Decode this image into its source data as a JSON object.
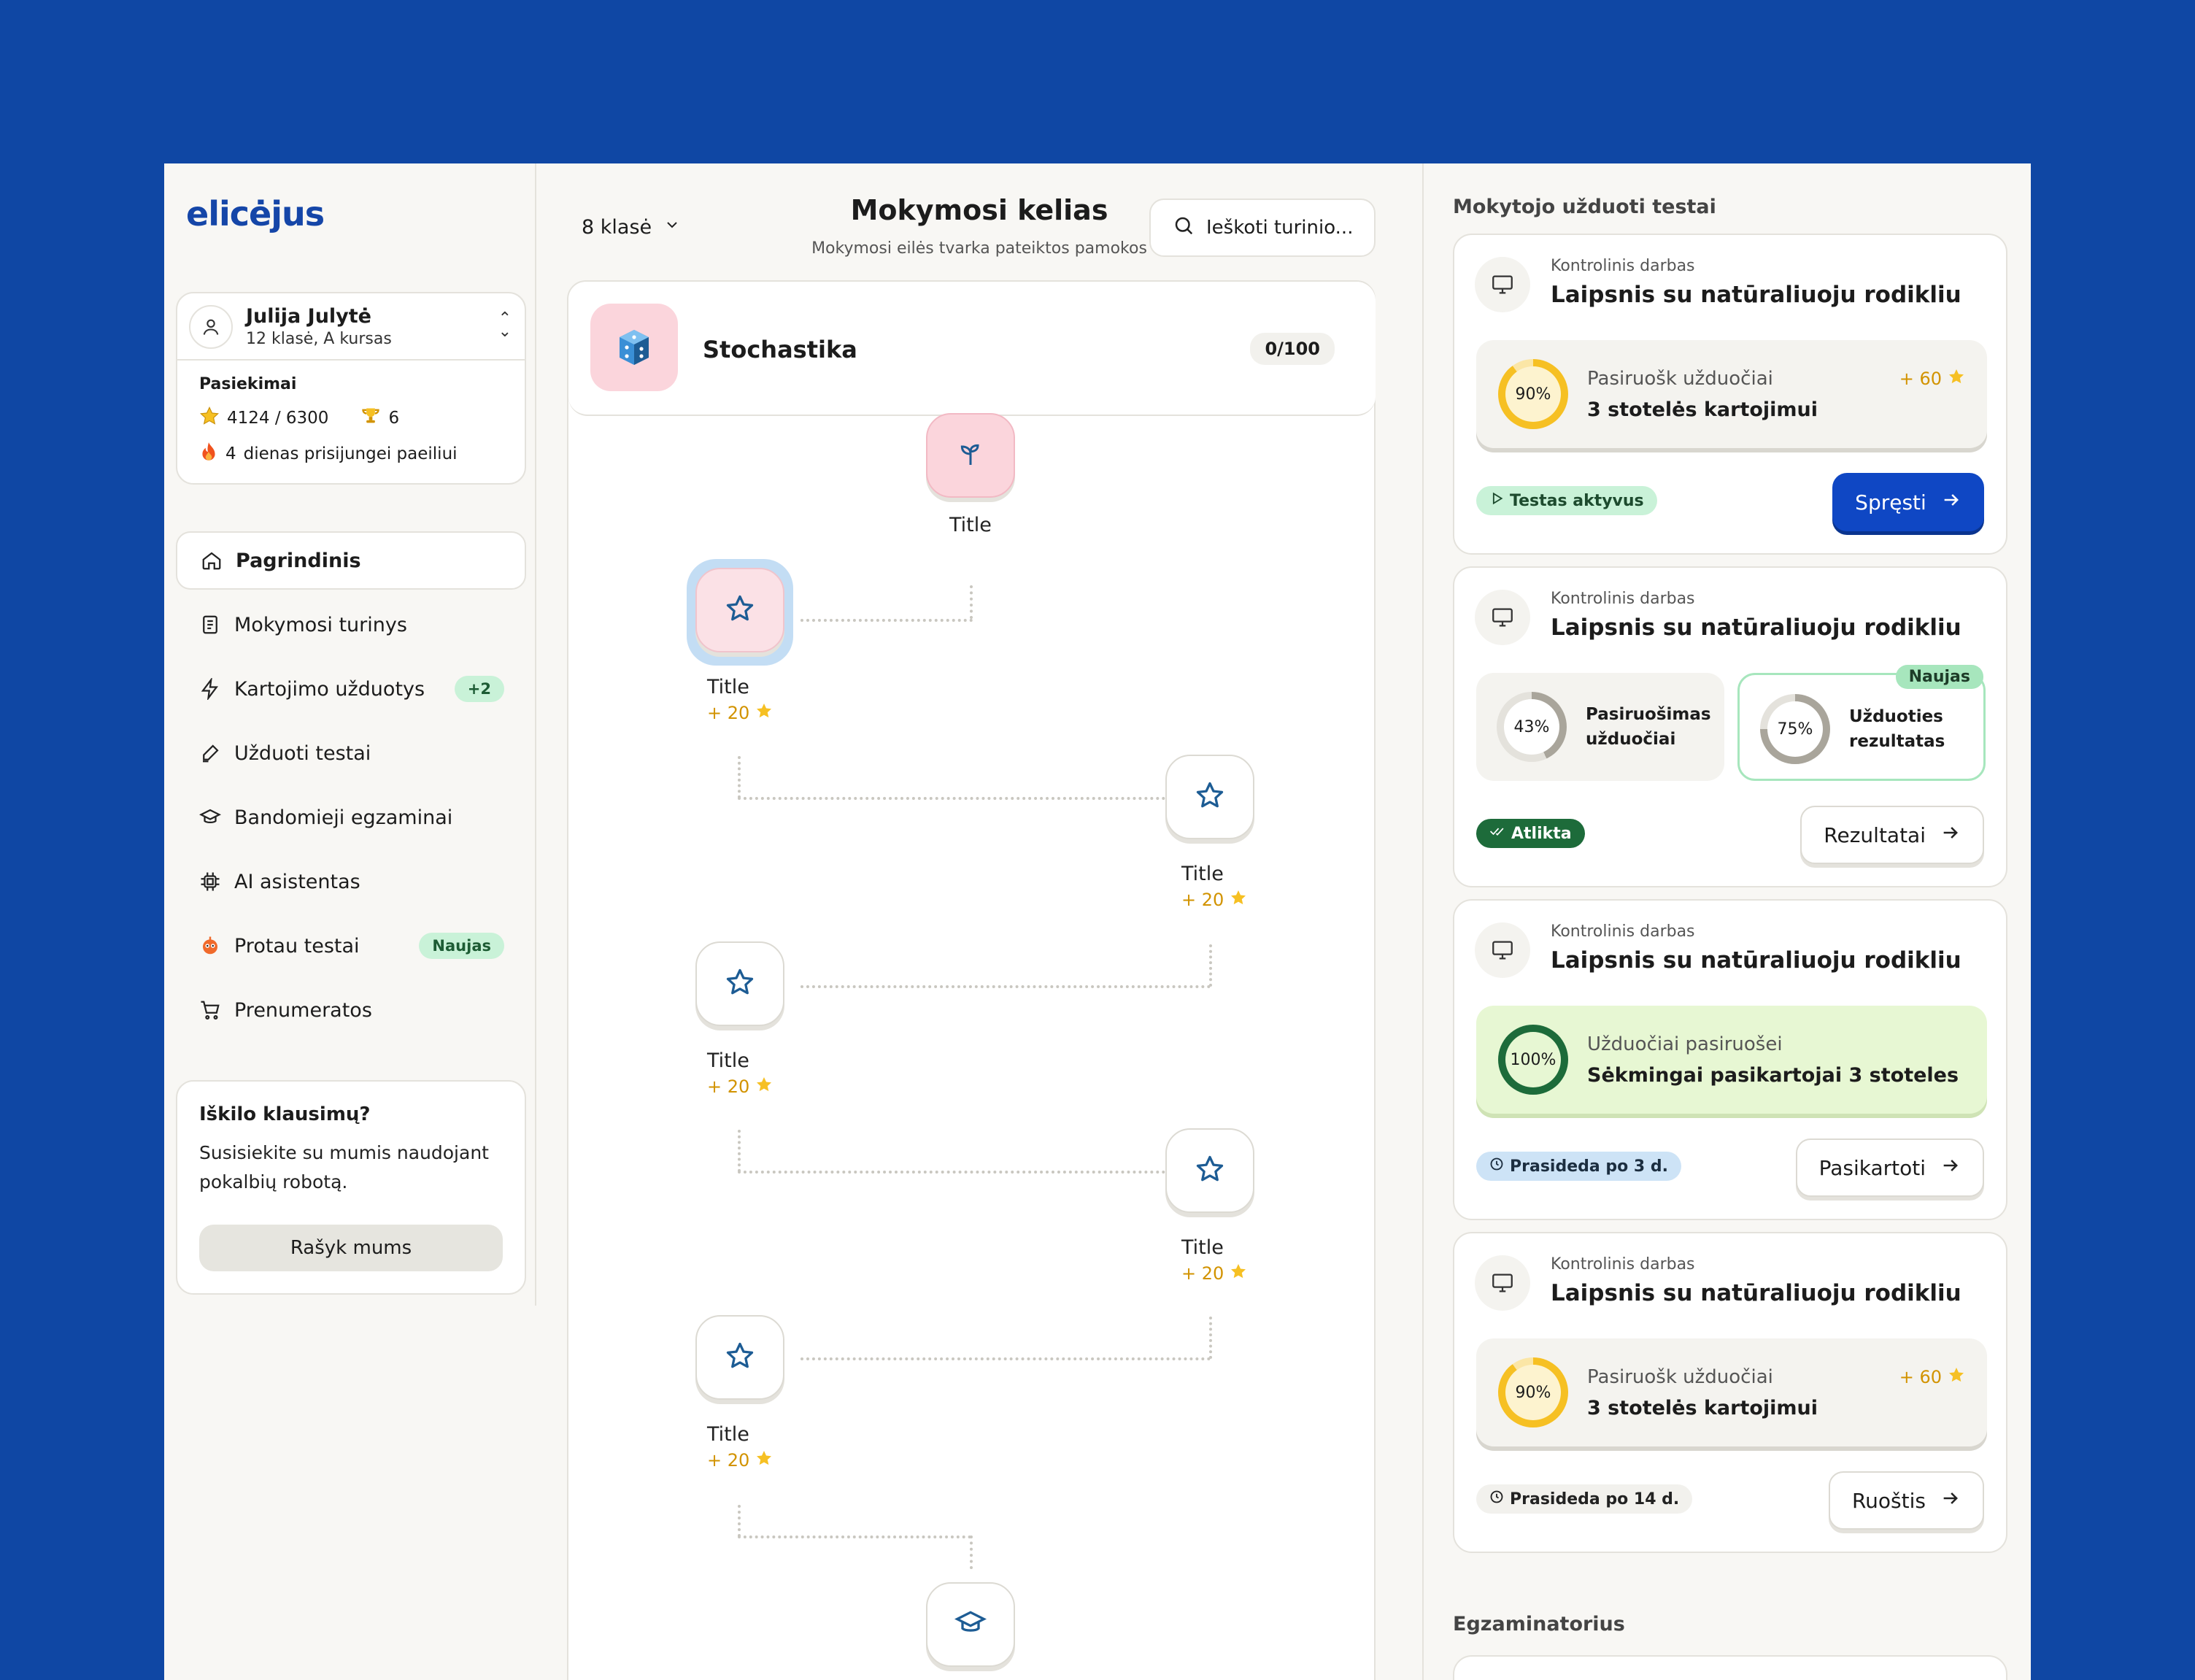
{
  "app": {
    "logo": "elicėjus"
  },
  "profile": {
    "name": "Julija Julytė",
    "subtitle": "12 klasė, A kursas"
  },
  "achievements": {
    "title": "Pasiekimai",
    "stars": "4124 / 6300",
    "trophies": "6",
    "streak_count": "4",
    "streak_label": "dienas prisijungei paeiliui"
  },
  "nav": [
    {
      "label": "Pagrindinis",
      "icon": "home-icon",
      "active": true
    },
    {
      "label": "Mokymosi turinys",
      "icon": "book-icon"
    },
    {
      "label": "Kartojimo užduotys",
      "icon": "lightning-icon",
      "badge": "+2"
    },
    {
      "label": "Užduoti testai",
      "icon": "pen-icon"
    },
    {
      "label": "Bandomieji egzaminai",
      "icon": "graduation-cap-icon"
    },
    {
      "label": "AI asistentas",
      "icon": "chip-icon"
    },
    {
      "label": "Protau testai",
      "icon": "robot-icon",
      "badge": "Naujas"
    },
    {
      "label": "Prenumeratos",
      "icon": "cart-icon"
    }
  ],
  "help": {
    "title": "Iškilo klausimų?",
    "text": "Susisiekite su mumis naudojant pokalbių robotą.",
    "button": "Rašyk mums"
  },
  "main": {
    "grade": "8 klasė",
    "title": "Mokymosi kelias",
    "subtitle": "Mokymosi eilės tvarka pateiktos pamokos",
    "search_placeholder": "Ieškoti turinio..."
  },
  "topic": {
    "name": "Stochastika",
    "count": "0/100"
  },
  "path_nodes": [
    {
      "label": "Title",
      "icon": "sprout-icon"
    },
    {
      "label": "Title",
      "points": "+ 20",
      "icon": "star-icon"
    },
    {
      "label": "Title",
      "points": "+ 20",
      "icon": "star-icon"
    },
    {
      "label": "Title",
      "points": "+ 20",
      "icon": "star-icon"
    },
    {
      "label": "Title",
      "points": "+ 20",
      "icon": "star-icon"
    },
    {
      "label": "Title",
      "points": "+ 20",
      "icon": "star-icon"
    },
    {
      "icon": "graduation-cap-icon"
    }
  ],
  "right": {
    "title": "Mokytojo užduoti testai",
    "title2": "Egzaminatorius"
  },
  "tests": [
    {
      "kind": "Kontrolinis darbas",
      "name": "Laipsnis su natūraliuoju rodikliu",
      "percent_label": "90%",
      "percent": 90,
      "line1": "Pasiruošk užduočiai",
      "line2": "3 stotelės kartojimui",
      "points": "+ 60",
      "status": "Testas aktyvus",
      "button": "Spręsti"
    },
    {
      "kind": "Kontrolinis darbas",
      "name": "Laipsnis su natūraliuoju rodikliu",
      "mini1_percent_label": "43%",
      "mini1_percent": 43,
      "mini1_text": "Pasiruošimas užduočiai",
      "mini2_percent_label": "75%",
      "mini2_percent": 75,
      "mini2_text": "Užduoties rezultatas",
      "mini2_tag": "Naujas",
      "status": "Atlikta",
      "button": "Rezultatai"
    },
    {
      "kind": "Kontrolinis darbas",
      "name": "Laipsnis su natūraliuoju rodikliu",
      "percent_label": "100%",
      "percent": 100,
      "line1": "Užduočiai pasiruošei",
      "line2": "Sėkmingai pasikartojai 3 stoteles",
      "status": "Prasideda po 3 d.",
      "button": "Pasikartoti"
    },
    {
      "kind": "Kontrolinis darbas",
      "name": "Laipsnis su natūraliuoju rodikliu",
      "percent_label": "90%",
      "percent": 90,
      "line1": "Pasiruošk užduočiai",
      "line2": "3 stotelės kartojimui",
      "points": "+ 60",
      "status": "Prasideda po 14 d.",
      "button": "Ruoštis"
    }
  ],
  "colors": {
    "brand": "#0F47A4",
    "primary_button": "#0f47c4",
    "points": "#d29300",
    "star_outline": "#1d5c94",
    "active_green": "#c9f2d8",
    "done_green": "#1d6b3a",
    "upcoming_blue": "#cde3f6"
  }
}
